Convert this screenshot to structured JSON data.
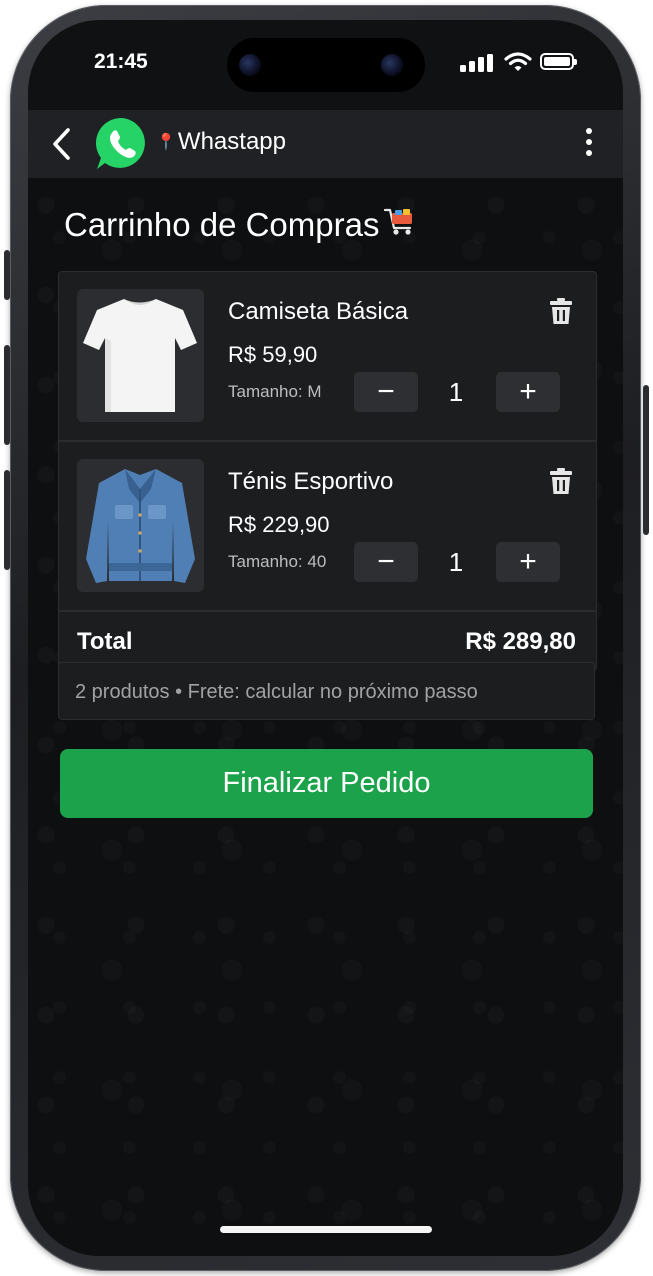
{
  "status_bar": {
    "time": "21:45"
  },
  "header": {
    "title": "Whastapp",
    "pin_glyph": "📍"
  },
  "page": {
    "title": "Carrinho de Compras",
    "title_emoji": "🛒"
  },
  "cart": {
    "items": [
      {
        "name": "Camiseta Básica",
        "price": "R$ 59,90",
        "size": "Tamanho: M",
        "quantity": "1",
        "image": "white-tshirt"
      },
      {
        "name": "Ténis Esportivo",
        "price": "R$ 229,90",
        "size": "Tamanho: 40",
        "quantity": "1",
        "image": "denim-jacket"
      }
    ],
    "minus_glyph": "−",
    "plus_glyph": "+",
    "total_label": "Total",
    "total_value": "R$ 289,80"
  },
  "summary": {
    "text": "2 produtos  •  Frete: calcular no próximo passo"
  },
  "checkout": {
    "label": "Finalizar Pedido"
  },
  "colors": {
    "accent_green": "#1ca24a",
    "whatsapp_green": "#25d366",
    "header_bg": "#1f2124",
    "card_bg": "#1b1d1f"
  },
  "icons": [
    "back-chevron-icon",
    "whatsapp-logo-icon",
    "pin-icon",
    "menu-dots-icon",
    "cart-icon",
    "trash-icon",
    "minus-icon",
    "plus-icon"
  ]
}
